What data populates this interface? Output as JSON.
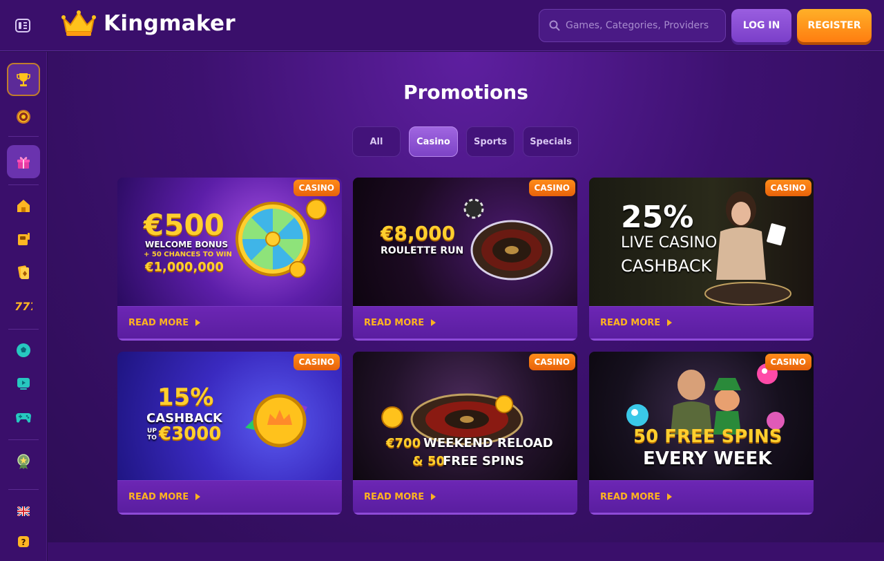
{
  "header": {
    "logo_text": "Kingmaker",
    "search_placeholder": "Games, Categories, Providers",
    "login_label": "LOG IN",
    "register_label": "REGISTER"
  },
  "colors": {
    "background": "#2a0d4f",
    "header": "#3a0f6b",
    "accent_orange": "#ff8c1a",
    "accent_purple": "#8e4bd8",
    "read_more": "#ffb41f"
  },
  "sidebar": {
    "items": [
      {
        "icon": "trophy-icon"
      },
      {
        "icon": "roulette-icon"
      },
      {
        "icon": "gift-icon"
      },
      {
        "icon": "home-icon"
      },
      {
        "icon": "live-casino-icon"
      },
      {
        "icon": "cards-icon"
      },
      {
        "icon": "slots-777-icon"
      },
      {
        "icon": "football-icon"
      },
      {
        "icon": "video-play-icon"
      },
      {
        "icon": "gamepad-icon"
      },
      {
        "icon": "medal-icon"
      },
      {
        "icon": "uk-flag-icon"
      },
      {
        "icon": "help-icon"
      }
    ]
  },
  "page": {
    "title": "Promotions",
    "filters": [
      "All",
      "Casino",
      "Sports",
      "Specials"
    ],
    "active_filter": "Casino"
  },
  "cards": [
    {
      "badge": "CASINO",
      "read_more": "READ MORE",
      "line1": "€500",
      "line2": "WELCOME BONUS",
      "line3": "+ 50 CHANCES TO WIN",
      "line4": "€1,000,000"
    },
    {
      "badge": "CASINO",
      "read_more": "READ MORE",
      "line1": "€8,000",
      "line2": "ROULETTE RUN"
    },
    {
      "badge": "CASINO",
      "read_more": "READ MORE",
      "line1": "25%",
      "line2": "LIVE CASINO",
      "line3": "CASHBACK"
    },
    {
      "badge": "CASINO",
      "read_more": "READ MORE",
      "line1": "15%",
      "line2": "CASHBACK",
      "line3": "UP TO",
      "line4": "€3000"
    },
    {
      "badge": "CASINO",
      "read_more": "READ MORE",
      "line1": "€700",
      "line2": "WEEKEND RELOAD",
      "line3": "& 50",
      "line4": "FREE SPINS"
    },
    {
      "badge": "CASINO",
      "read_more": "READ MORE",
      "line1": "50 FREE SPINS",
      "line2": "EVERY WEEK"
    }
  ]
}
